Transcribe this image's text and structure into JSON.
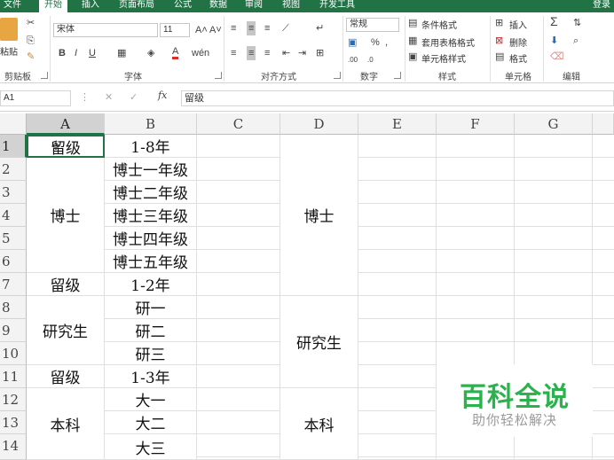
{
  "tabs": [
    "文件",
    "开始",
    "插入",
    "页面布局",
    "公式",
    "数据",
    "审阅",
    "视图",
    "开发工具"
  ],
  "login": "登录",
  "ribbon": {
    "paste": "粘贴",
    "font_name": "宋体",
    "font_size": "11",
    "number_format": "常规",
    "cond_format": "条件格式",
    "table_format": "套用表格格式",
    "cell_style": "单元格样式",
    "insert": "插入",
    "delete": "删除",
    "format": "格式",
    "groups": {
      "clipboard": "剪贴板",
      "font": "字体",
      "align": "对齐方式",
      "number": "数字",
      "style": "样式",
      "cells": "单元格",
      "edit": "编辑"
    }
  },
  "formula_bar": {
    "name_box": "A1",
    "fx": "fx",
    "content": "留级"
  },
  "columns": [
    "A",
    "B",
    "C",
    "D",
    "E",
    "F",
    "G"
  ],
  "rows": [
    "1",
    "2",
    "3",
    "4",
    "5",
    "6",
    "7",
    "8",
    "9",
    "10",
    "11",
    "12",
    "13",
    "14"
  ],
  "cells": {
    "A1": "留级",
    "A2_6": "博士",
    "A7": "留级",
    "A8_10": "研究生",
    "A11": "留级",
    "A12_14": "本科",
    "B1": "1-8年",
    "B2": "博士一年级",
    "B3": "博士二年级",
    "B4": "博士三年级",
    "B5": "博士四年级",
    "B6": "博士五年级",
    "B7": "1-2年",
    "B8": "研一",
    "B9": "研二",
    "B10": "研三",
    "B11": "1-3年",
    "B12": "大一",
    "B13": "大二",
    "B14": "大三",
    "D1_6": "博士",
    "D7_10": "研究生",
    "D11_14": "本科"
  },
  "watermark": {
    "title": "百科全说",
    "subtitle": "助你轻松解决"
  },
  "colors": {
    "excel_green": "#217346",
    "watermark_green": "#2bb24c"
  }
}
